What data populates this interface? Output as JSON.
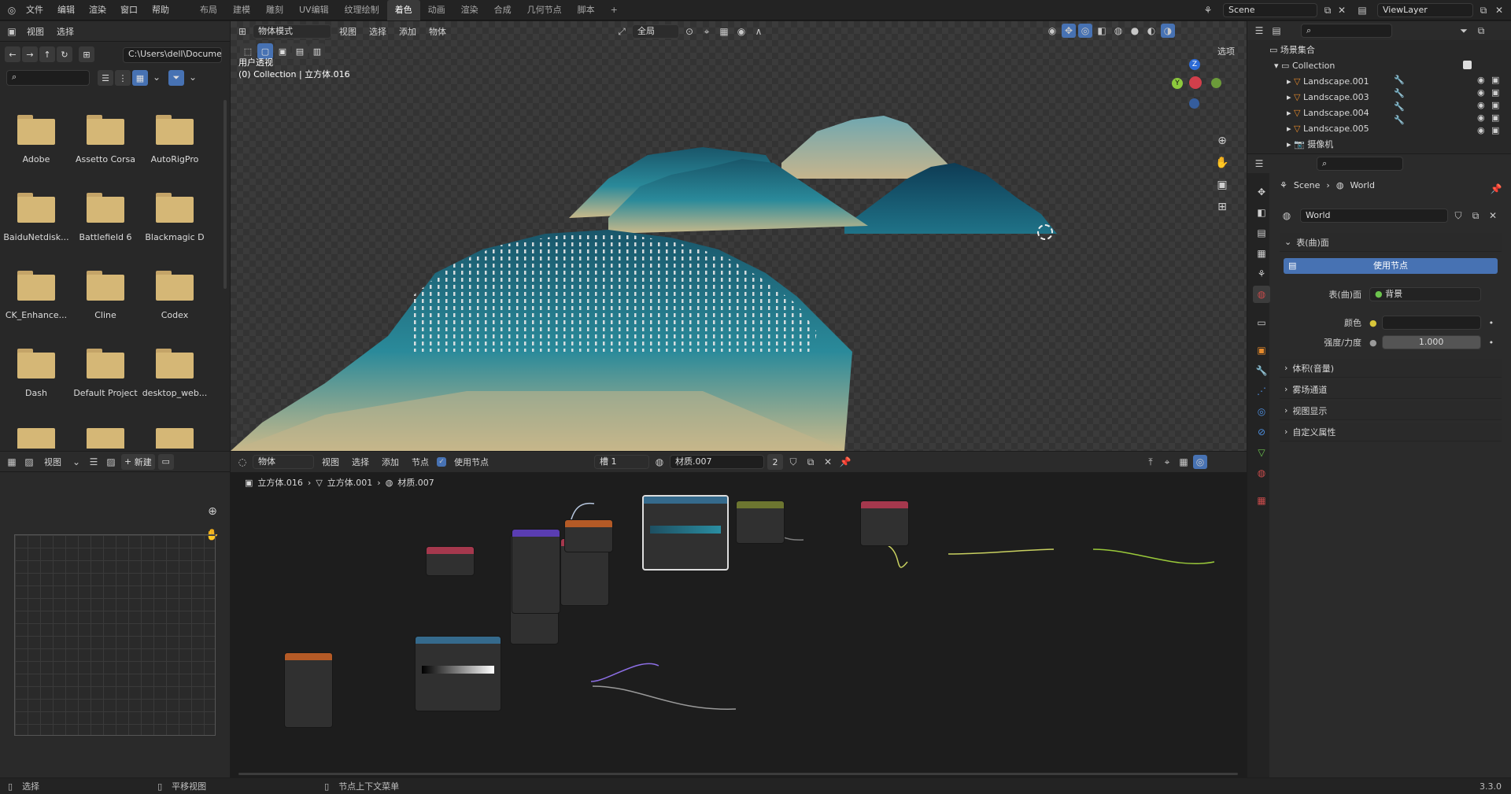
{
  "topbar": {
    "menus": [
      "文件",
      "编辑",
      "渲染",
      "窗口",
      "帮助"
    ],
    "workspaces": [
      "布局",
      "建模",
      "雕刻",
      "UV编辑",
      "纹理绘制",
      "着色",
      "动画",
      "渲染",
      "合成",
      "几何节点",
      "脚本"
    ],
    "active_workspace": "着色",
    "add_tab": "+",
    "scene": "Scene",
    "view_layer": "ViewLayer"
  },
  "file_browser": {
    "menus": [
      "视图",
      "选择"
    ],
    "path": "C:\\Users\\dell\\Docume...",
    "folders": [
      "Adobe",
      "Assetto Corsa",
      "AutoRigPro",
      "BaiduNetdisk...",
      "Battlefield 6",
      "Blackmagic D",
      "CK_Enhance...",
      "Cline",
      "Codex",
      "Dash",
      "Default Project",
      "desktop_web..."
    ]
  },
  "viewport": {
    "mode": "物体模式",
    "menus": [
      "视图",
      "选择",
      "添加",
      "物体"
    ],
    "transform": "全局",
    "options": "选项",
    "overlay_title": "用户透视",
    "overlay_subtitle": "(0) Collection | 立方体.016",
    "gizmo": {
      "z": "Z",
      "y": "Y"
    }
  },
  "image_editor": {
    "view_menu": "视图",
    "new_button": "新建"
  },
  "node_editor": {
    "object_mode": "物体",
    "menus": [
      "视图",
      "选择",
      "添加",
      "节点"
    ],
    "use_nodes_label": "使用节点",
    "use_nodes": true,
    "slot": "槽 1",
    "material": "材质.007",
    "users": "2",
    "breadcrumb": [
      "立方体.016",
      "立方体.001",
      "材质.007"
    ]
  },
  "outliner": {
    "title": "场景集合",
    "collection": "Collection",
    "items": [
      "Landscape.001",
      "Landscape.003",
      "Landscape.004",
      "Landscape.005",
      "摄像机"
    ]
  },
  "properties": {
    "breadcrumb": [
      "Scene",
      "World"
    ],
    "world_name": "World",
    "surface_section": "表(曲)面",
    "use_nodes_button": "使用节点",
    "surface_label": "表(曲)面",
    "surface_value": "背景",
    "color_label": "颜色",
    "strength_label": "强度/力度",
    "strength_value": "1.000",
    "sections": [
      "体积(音量)",
      "雾场通道",
      "视图显示",
      "自定义属性"
    ]
  },
  "statusbar": {
    "select": "选择",
    "pan": "平移视图",
    "context": "节点上下文菜单",
    "version": "3.3.0"
  },
  "colors": {
    "accent": "#4772b3",
    "header": "#2b2b2b",
    "folder": "#d5b776",
    "teal": "#1f6e80",
    "sand": "#c7b98c"
  }
}
